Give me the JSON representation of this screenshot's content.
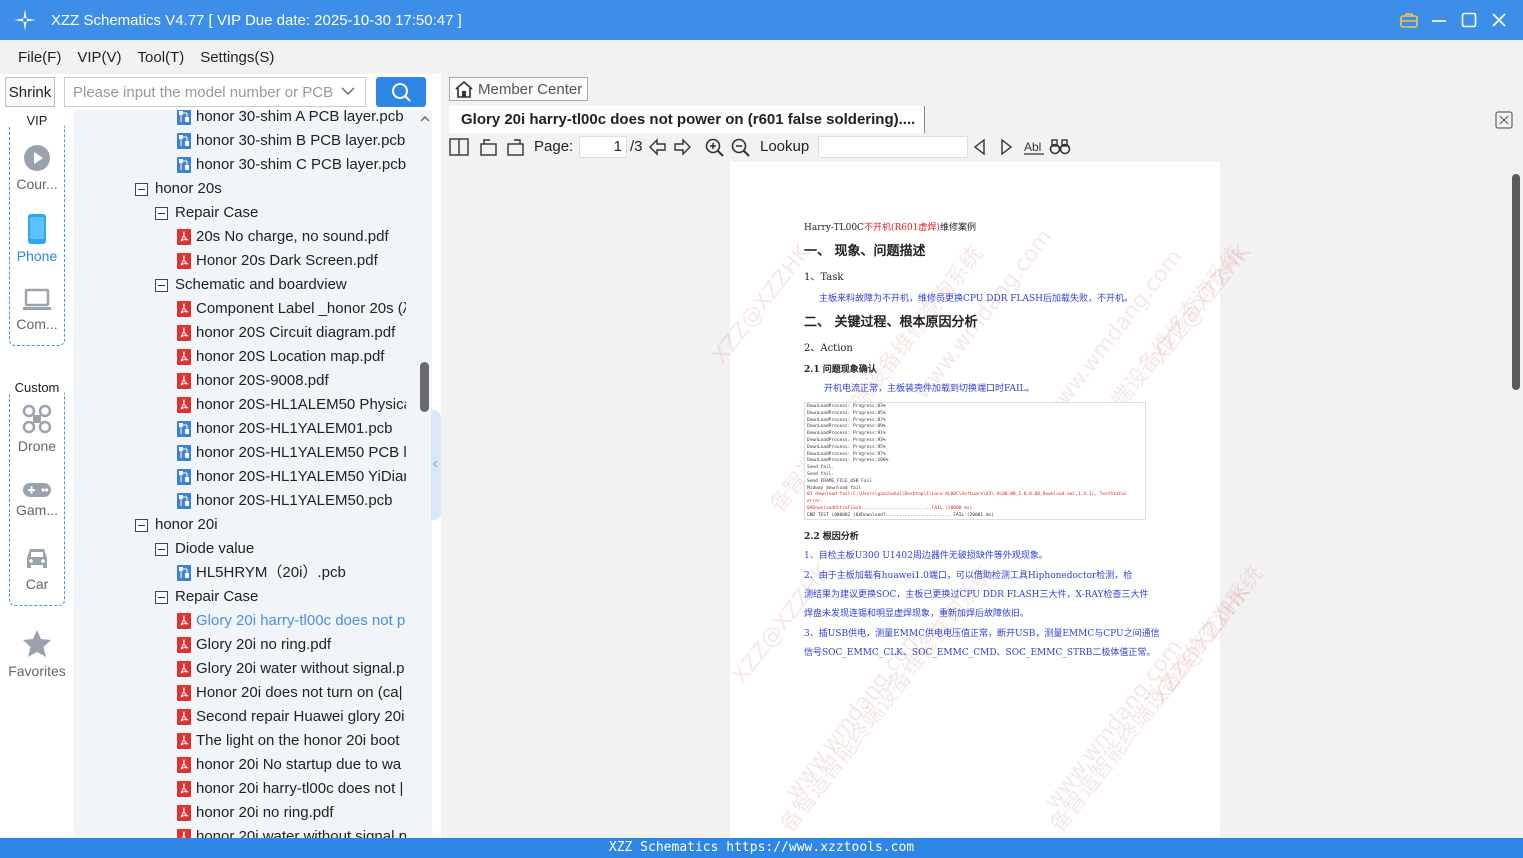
{
  "window": {
    "title": "XZZ Schematics V4.77 [ VIP Due date: 2025-10-30 17:50:47 ]"
  },
  "menu": [
    "File(F)",
    "VIP(V)",
    "Tool(T)",
    "Settings(S)"
  ],
  "leftnav": {
    "shrink_label": "Shrink",
    "vip_label": "VIP",
    "custom_label": "Custom",
    "items": [
      {
        "label": "Cour...",
        "icon": "play-icon"
      },
      {
        "label": "Phone",
        "icon": "phone-icon",
        "active": true
      },
      {
        "label": "Com...",
        "icon": "laptop-icon"
      },
      {
        "label": "Drone",
        "icon": "drone-icon"
      },
      {
        "label": "Gam...",
        "icon": "gamepad-icon"
      },
      {
        "label": "Car",
        "icon": "car-icon"
      },
      {
        "label": "Favorites",
        "icon": "star-icon"
      }
    ]
  },
  "search": {
    "placeholder": "Please input the model number or PCB"
  },
  "tree": [
    {
      "level": 3,
      "type": "pcb",
      "label": "honor 30-shim A PCB layer.pcb"
    },
    {
      "level": 3,
      "type": "pcb",
      "label": "honor 30-shim B PCB layer.pcb"
    },
    {
      "level": 3,
      "type": "pcb",
      "label": "honor 30-shim C PCB layer.pcb"
    },
    {
      "level": 1,
      "type": "folder",
      "label": "honor 20s"
    },
    {
      "level": 2,
      "type": "folder",
      "label": "Repair Case"
    },
    {
      "level": 3,
      "type": "pdf",
      "label": "20s No charge, no sound.pdf"
    },
    {
      "level": 3,
      "type": "pdf",
      "label": "Honor 20s Dark Screen.pdf"
    },
    {
      "level": 2,
      "type": "folder",
      "label": "Schematic and boardview"
    },
    {
      "level": 3,
      "type": "pdf",
      "label": "Component Label _honor 20s (λ"
    },
    {
      "level": 3,
      "type": "pdf",
      "label": "honor 20S Circuit diagram.pdf"
    },
    {
      "level": 3,
      "type": "pdf",
      "label": "honor 20S Location map.pdf"
    },
    {
      "level": 3,
      "type": "pdf",
      "label": "honor 20S-9008.pdf"
    },
    {
      "level": 3,
      "type": "pdf",
      "label": "honor 20S-HL1ALEM50 Physica"
    },
    {
      "level": 3,
      "type": "pcb",
      "label": "honor 20S-HL1YALEM01.pcb"
    },
    {
      "level": 3,
      "type": "pcb",
      "label": "honor 20S-HL1YALEM50 PCB la"
    },
    {
      "level": 3,
      "type": "pcb",
      "label": "honor 20S-HL1YALEM50 YiDian"
    },
    {
      "level": 3,
      "type": "pcb",
      "label": "honor 20S-HL1YALEM50.pcb"
    },
    {
      "level": 1,
      "type": "folder",
      "label": "honor 20i"
    },
    {
      "level": 2,
      "type": "folder",
      "label": "Diode value"
    },
    {
      "level": 3,
      "type": "pcb",
      "label": "HL5HRYM（20i）.pcb"
    },
    {
      "level": 2,
      "type": "folder",
      "label": "Repair Case"
    },
    {
      "level": 3,
      "type": "pdf",
      "label": "Glory 20i harry-tl00c does not p",
      "selected": true
    },
    {
      "level": 3,
      "type": "pdf",
      "label": "Glory 20i no ring.pdf"
    },
    {
      "level": 3,
      "type": "pdf",
      "label": "Glory 20i water without signal.p"
    },
    {
      "level": 3,
      "type": "pdf",
      "label": "Honor 20i does not turn on (ca|"
    },
    {
      "level": 3,
      "type": "pdf",
      "label": "Second repair Huawei glory 20i"
    },
    {
      "level": 3,
      "type": "pdf",
      "label": "The light on the honor 20i boot"
    },
    {
      "level": 3,
      "type": "pdf",
      "label": "honor 20i No startup due to wa"
    },
    {
      "level": 3,
      "type": "pdf",
      "label": "honor 20i harry-tl00c does not |"
    },
    {
      "level": 3,
      "type": "pdf",
      "label": "honor 20i no ring.pdf"
    },
    {
      "level": 3,
      "type": "pdf",
      "label": "honor 20i water without signal.p"
    }
  ],
  "viewer": {
    "member_center": "Member Center",
    "tab_title": "Glory 20i harry-tl00c does not power on (r601 false soldering)....",
    "page_label": "Page:",
    "page_current": "1",
    "page_total": "/3",
    "lookup_label": "Lookup",
    "lookup_value": ""
  },
  "document": {
    "header_prefix": "Harry-TL00C",
    "header_red": "不开机(R601虚焊)",
    "header_suffix": "维修案例",
    "h1_a": "一、  现象、问题描述",
    "task": "1、Task",
    "task_text": "主板来料故障为不开机，维修员更换CPU DDR FLASH后加载失败，不开机。",
    "h1_b": "二、  关键过程、根本原因分析",
    "action": "2、Action",
    "s21": "2.1 问题现象确认",
    "s21_text": "开机电流正常，主板装壳件加载到切换端口时FAIL。",
    "log_lines": [
      "DownLoadProcess: Progress:83%",
      "DownLoadProcess: Progress:85%",
      "DownLoadProcess: Progress:87%",
      "DownLoadProcess: Progress:89%",
      "DownLoadProcess: Progress:91%",
      "DownLoadProcess: Progress:93%",
      "DownLoadProcess: Progress:95%",
      "DownLoadProcess: Progress:97%",
      "DownLoadProcess: Progress:100%",
      "Send fail.",
      "Send fail.",
      "Send FRAME_FILE_USB Fail",
      "Midway download fail"
    ],
    "log_err_lines": [
      "01 download fail:C:\\Users\\gaochuhui\\Desktop\\1\\Laco-AL00C\\Software\\U3\\-AL00-BB_1.0.0.60_Download.xml,1,4.1), TestStatus error.",
      "         0XDownloadUltraFlash......................... FAIL (20000 ms)"
    ],
    "log_tail": "END   TEST (000002 (0XDownload?........................ FAIL (20001 ms)",
    "s22": "2.2 根因分析",
    "s22_lines": [
      "1、目检主板U300 U1402周边器件无破损缺件等外观现象。",
      "2、由于主板加载有huawei1.0端口，可以借助检测工具Hiphonedoctor检测，检",
      "测结果为建议更换SOC，主板已更换过CPU DDR FLASH三大件，X-RAY检查三大件",
      "焊盘未发现连锡和明显虚焊现象，重新加焊后故障依旧。",
      "3、插USB供电，测量EMMC供电电压值正常，断开USB，测量EMMC与CPU之间通信",
      "信号SOC_EMMC_CLK、SOC_EMMC_CMD、SOC_EMMC_STRB二极体值正常。"
    ],
    "watermarks": [
      "XZZ@XZZHK",
      "备智造智能终端设备维修查询系统",
      "www.wmdang.com"
    ]
  },
  "statusbar": {
    "text": "XZZ Schematics https://www.xzztools.com"
  },
  "colors": {
    "accent": "#2e86e6",
    "titlebar": "#3c8ee8",
    "selected_item": "#4a90e2",
    "doc_red": "#dd2222",
    "doc_blue": "#2d3fd6"
  }
}
